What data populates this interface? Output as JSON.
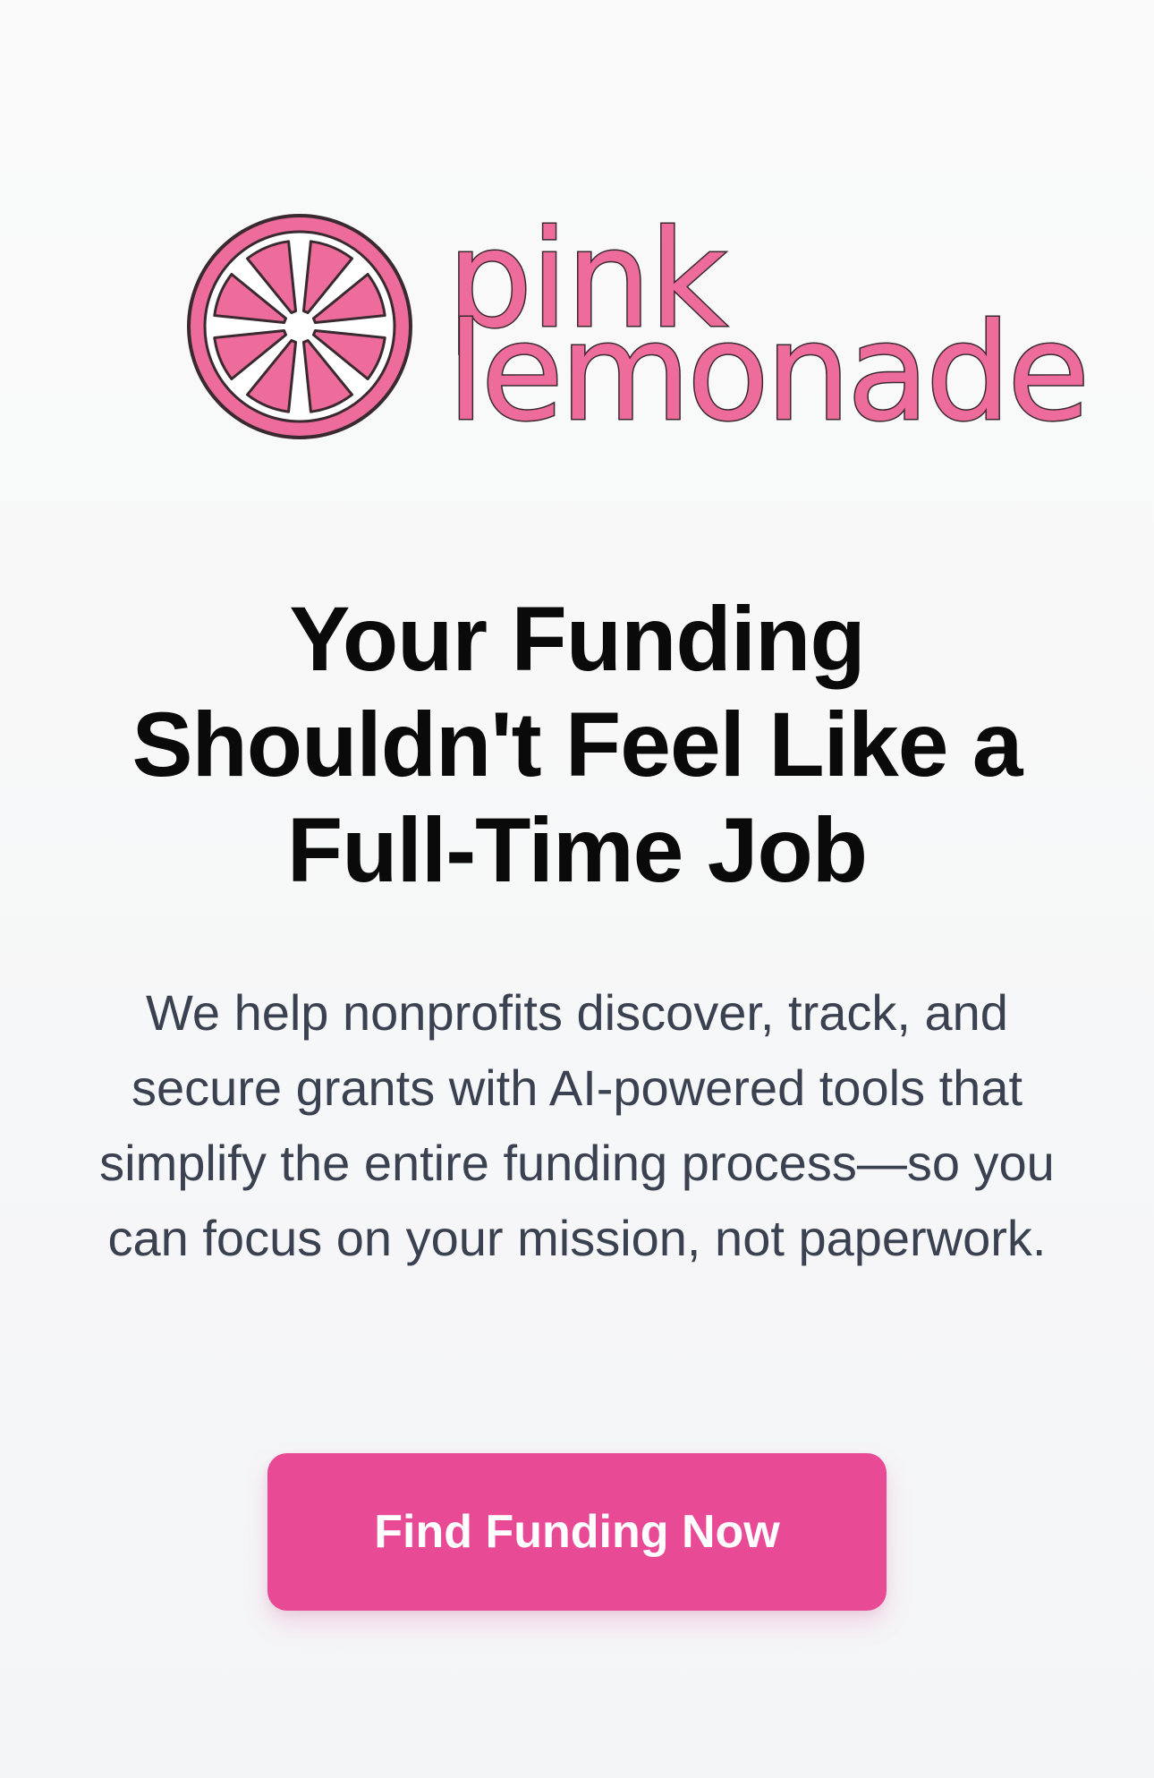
{
  "brand": {
    "name_line1": "pink",
    "name_line2": "lemonade",
    "logo_icon": "lemon-slice-icon",
    "colors": {
      "logo_pink": "#ee6c9c",
      "logo_outline": "#3a2a30",
      "cta_pink": "#e84a96",
      "headline": "#0a0a0a",
      "body_text": "#3a4150"
    }
  },
  "hero": {
    "headline": "Your Funding Shouldn't Feel Like a Full-Time Job",
    "subtext": "We help nonprofits discover, track, and secure grants with AI-powered tools that simplify the entire funding process—so you can focus on your mission, not paperwork.",
    "cta_label": "Find Funding Now"
  }
}
